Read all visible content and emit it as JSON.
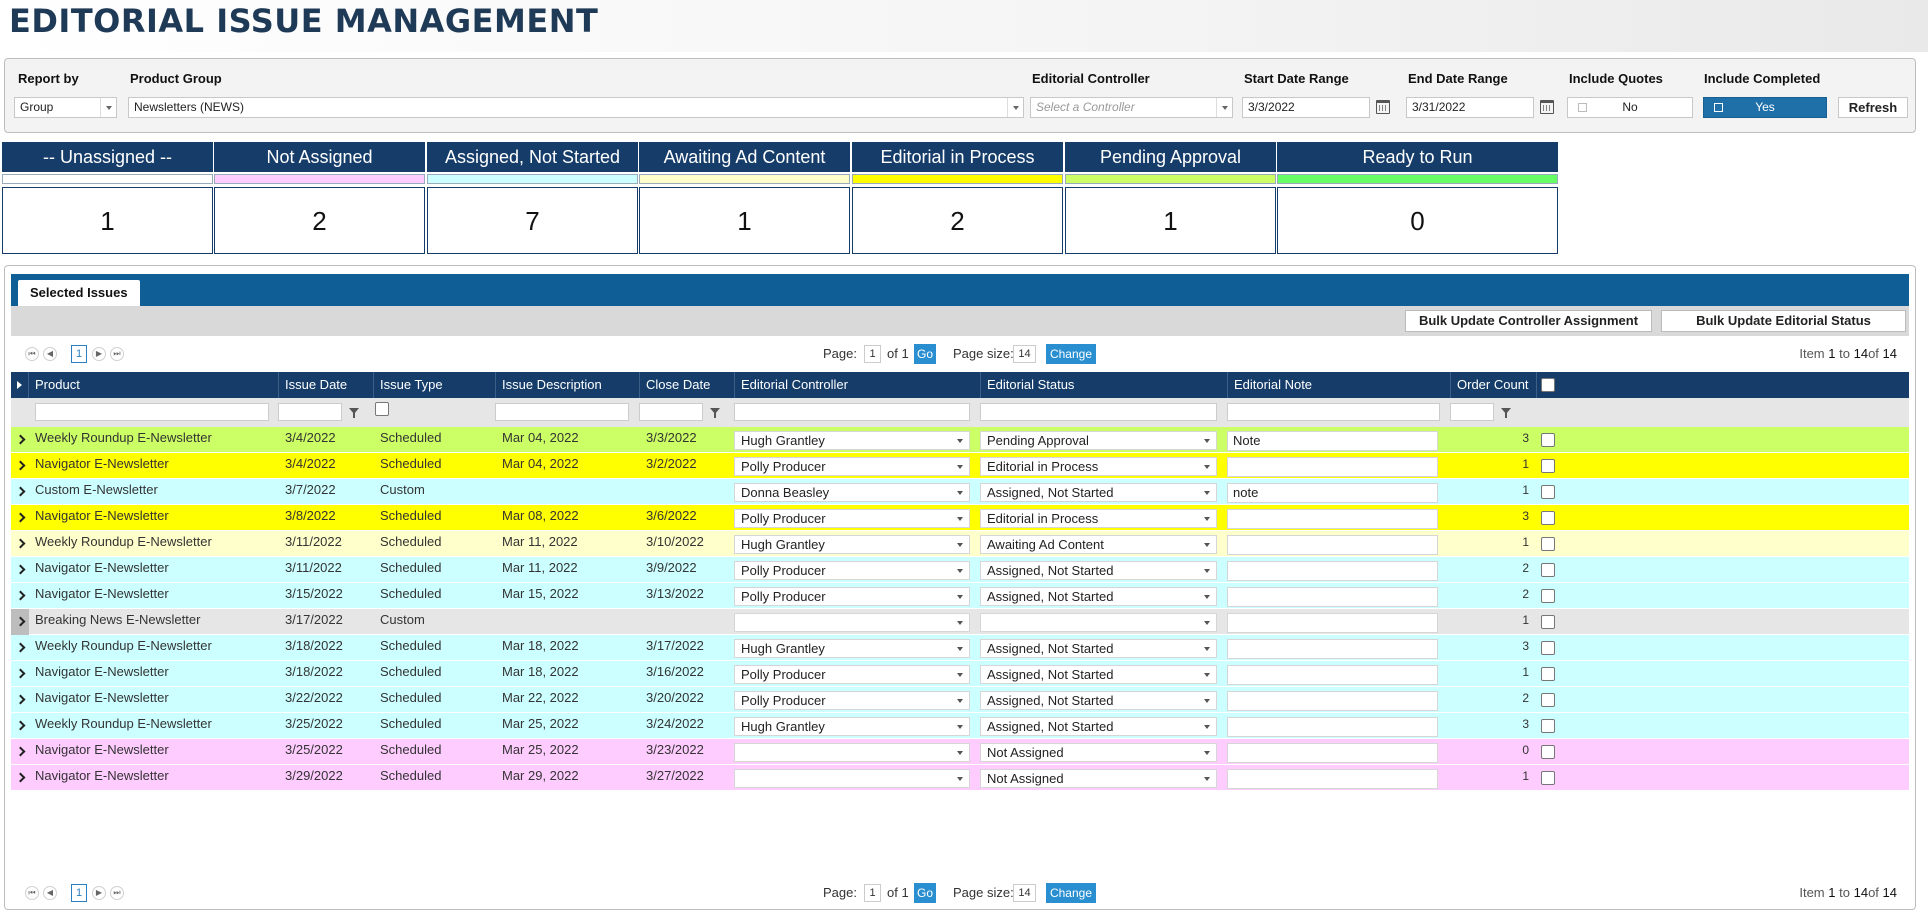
{
  "page": {
    "title": "EDITORIAL ISSUE MANAGEMENT"
  },
  "filters": {
    "report_by_label": "Report by",
    "report_by_value": "Group",
    "product_group_label": "Product Group",
    "product_group_value": "Newsletters (NEWS)",
    "controller_label": "Editorial Controller",
    "controller_placeholder": "Select a Controller",
    "start_label": "Start Date Range",
    "start_value": "3/3/2022",
    "end_label": "End Date Range",
    "end_value": "3/31/2022",
    "quotes_label": "Include Quotes",
    "quotes_value": "No",
    "completed_label": "Include Completed",
    "completed_value": "Yes",
    "refresh_label": "Refresh"
  },
  "status_cards": [
    {
      "label": "-- Unassigned --",
      "count": "1",
      "color": "#ffffff"
    },
    {
      "label": "Not Assigned",
      "count": "2",
      "color": "#ffccff"
    },
    {
      "label": "Assigned, Not Started",
      "count": "7",
      "color": "#ccffff"
    },
    {
      "label": "Awaiting Ad Content",
      "count": "1",
      "color": "#ffffcc"
    },
    {
      "label": "Editorial in Process",
      "count": "2",
      "color": "#ffff00"
    },
    {
      "label": "Pending Approval",
      "count": "1",
      "color": "#ccff66"
    },
    {
      "label": "Ready to Run",
      "count": "0",
      "color": "#66ff66"
    }
  ],
  "grid": {
    "tab_label": "Selected Issues",
    "bulk_controller_label": "Bulk Update Controller Assignment",
    "bulk_status_label": "Bulk Update Editorial Status",
    "pager": {
      "page_label": "Page:",
      "page_value": "1",
      "of_label": "of 1",
      "go_label": "Go",
      "size_label": "Page size:",
      "size_value": "14",
      "change_label": "Change",
      "current_page": "1",
      "info_prefix": "Item",
      "info_from": "1",
      "info_to_label": "to",
      "info_to": "14",
      "info_of_label": "of",
      "info_total": "14"
    },
    "columns": {
      "product": "Product",
      "issue_date": "Issue Date",
      "issue_type": "Issue Type",
      "issue_description": "Issue Description",
      "close_date": "Close Date",
      "editorial_controller": "Editorial Controller",
      "editorial_status": "Editorial Status",
      "editorial_note": "Editorial Note",
      "order_count": "Order Count"
    },
    "rows": [
      {
        "product": "Weekly Roundup E-Newsletter",
        "issue_date": "3/4/2022",
        "issue_type": "Scheduled",
        "description": "Mar 04, 2022",
        "close_date": "3/3/2022",
        "controller": "Hugh Grantley",
        "status": "Pending Approval",
        "note": "Note",
        "count": "3",
        "row_color": "#ccff66"
      },
      {
        "product": "Navigator E-Newsletter",
        "issue_date": "3/4/2022",
        "issue_type": "Scheduled",
        "description": "Mar 04, 2022",
        "close_date": "3/2/2022",
        "controller": "Polly Producer",
        "status": "Editorial in Process",
        "note": "",
        "count": "1",
        "row_color": "#ffff00"
      },
      {
        "product": "Custom E-Newsletter",
        "issue_date": "3/7/2022",
        "issue_type": "Custom",
        "description": "",
        "close_date": "",
        "controller": "Donna Beasley",
        "status": "Assigned, Not Started",
        "note": "note",
        "count": "1",
        "row_color": "#ccffff"
      },
      {
        "product": "Navigator E-Newsletter",
        "issue_date": "3/8/2022",
        "issue_type": "Scheduled",
        "description": "Mar 08, 2022",
        "close_date": "3/6/2022",
        "controller": "Polly Producer",
        "status": "Editorial in Process",
        "note": "",
        "count": "3",
        "row_color": "#ffff00"
      },
      {
        "product": "Weekly Roundup E-Newsletter",
        "issue_date": "3/11/2022",
        "issue_type": "Scheduled",
        "description": "Mar 11, 2022",
        "close_date": "3/10/2022",
        "controller": "Hugh Grantley",
        "status": "Awaiting Ad Content",
        "note": "",
        "count": "1",
        "row_color": "#ffffcc"
      },
      {
        "product": "Navigator E-Newsletter",
        "issue_date": "3/11/2022",
        "issue_type": "Scheduled",
        "description": "Mar 11, 2022",
        "close_date": "3/9/2022",
        "controller": "Polly Producer",
        "status": "Assigned, Not Started",
        "note": "",
        "count": "2",
        "row_color": "#ccffff"
      },
      {
        "product": "Navigator E-Newsletter",
        "issue_date": "3/15/2022",
        "issue_type": "Scheduled",
        "description": "Mar 15, 2022",
        "close_date": "3/13/2022",
        "controller": "Polly Producer",
        "status": "Assigned, Not Started",
        "note": "",
        "count": "2",
        "row_color": "#ccffff"
      },
      {
        "product": "Breaking News E-Newsletter",
        "issue_date": "3/17/2022",
        "issue_type": "Custom",
        "description": "",
        "close_date": "",
        "controller": "",
        "status": "",
        "note": "",
        "count": "1",
        "row_color": "#e6e6e6"
      },
      {
        "product": "Weekly Roundup E-Newsletter",
        "issue_date": "3/18/2022",
        "issue_type": "Scheduled",
        "description": "Mar 18, 2022",
        "close_date": "3/17/2022",
        "controller": "Hugh Grantley",
        "status": "Assigned, Not Started",
        "note": "",
        "count": "3",
        "row_color": "#ccffff"
      },
      {
        "product": "Navigator E-Newsletter",
        "issue_date": "3/18/2022",
        "issue_type": "Scheduled",
        "description": "Mar 18, 2022",
        "close_date": "3/16/2022",
        "controller": "Polly Producer",
        "status": "Assigned, Not Started",
        "note": "",
        "count": "1",
        "row_color": "#ccffff"
      },
      {
        "product": "Navigator E-Newsletter",
        "issue_date": "3/22/2022",
        "issue_type": "Scheduled",
        "description": "Mar 22, 2022",
        "close_date": "3/20/2022",
        "controller": "Polly Producer",
        "status": "Assigned, Not Started",
        "note": "",
        "count": "2",
        "row_color": "#ccffff"
      },
      {
        "product": "Weekly Roundup E-Newsletter",
        "issue_date": "3/25/2022",
        "issue_type": "Scheduled",
        "description": "Mar 25, 2022",
        "close_date": "3/24/2022",
        "controller": "Hugh Grantley",
        "status": "Assigned, Not Started",
        "note": "",
        "count": "3",
        "row_color": "#ccffff"
      },
      {
        "product": "Navigator E-Newsletter",
        "issue_date": "3/25/2022",
        "issue_type": "Scheduled",
        "description": "Mar 25, 2022",
        "close_date": "3/23/2022",
        "controller": "",
        "status": "Not Assigned",
        "note": "",
        "count": "0",
        "row_color": "#ffccff"
      },
      {
        "product": "Navigator E-Newsletter",
        "issue_date": "3/29/2022",
        "issue_type": "Scheduled",
        "description": "Mar 29, 2022",
        "close_date": "3/27/2022",
        "controller": "",
        "status": "Not Assigned",
        "note": "",
        "count": "1",
        "row_color": "#ffccff"
      }
    ]
  }
}
